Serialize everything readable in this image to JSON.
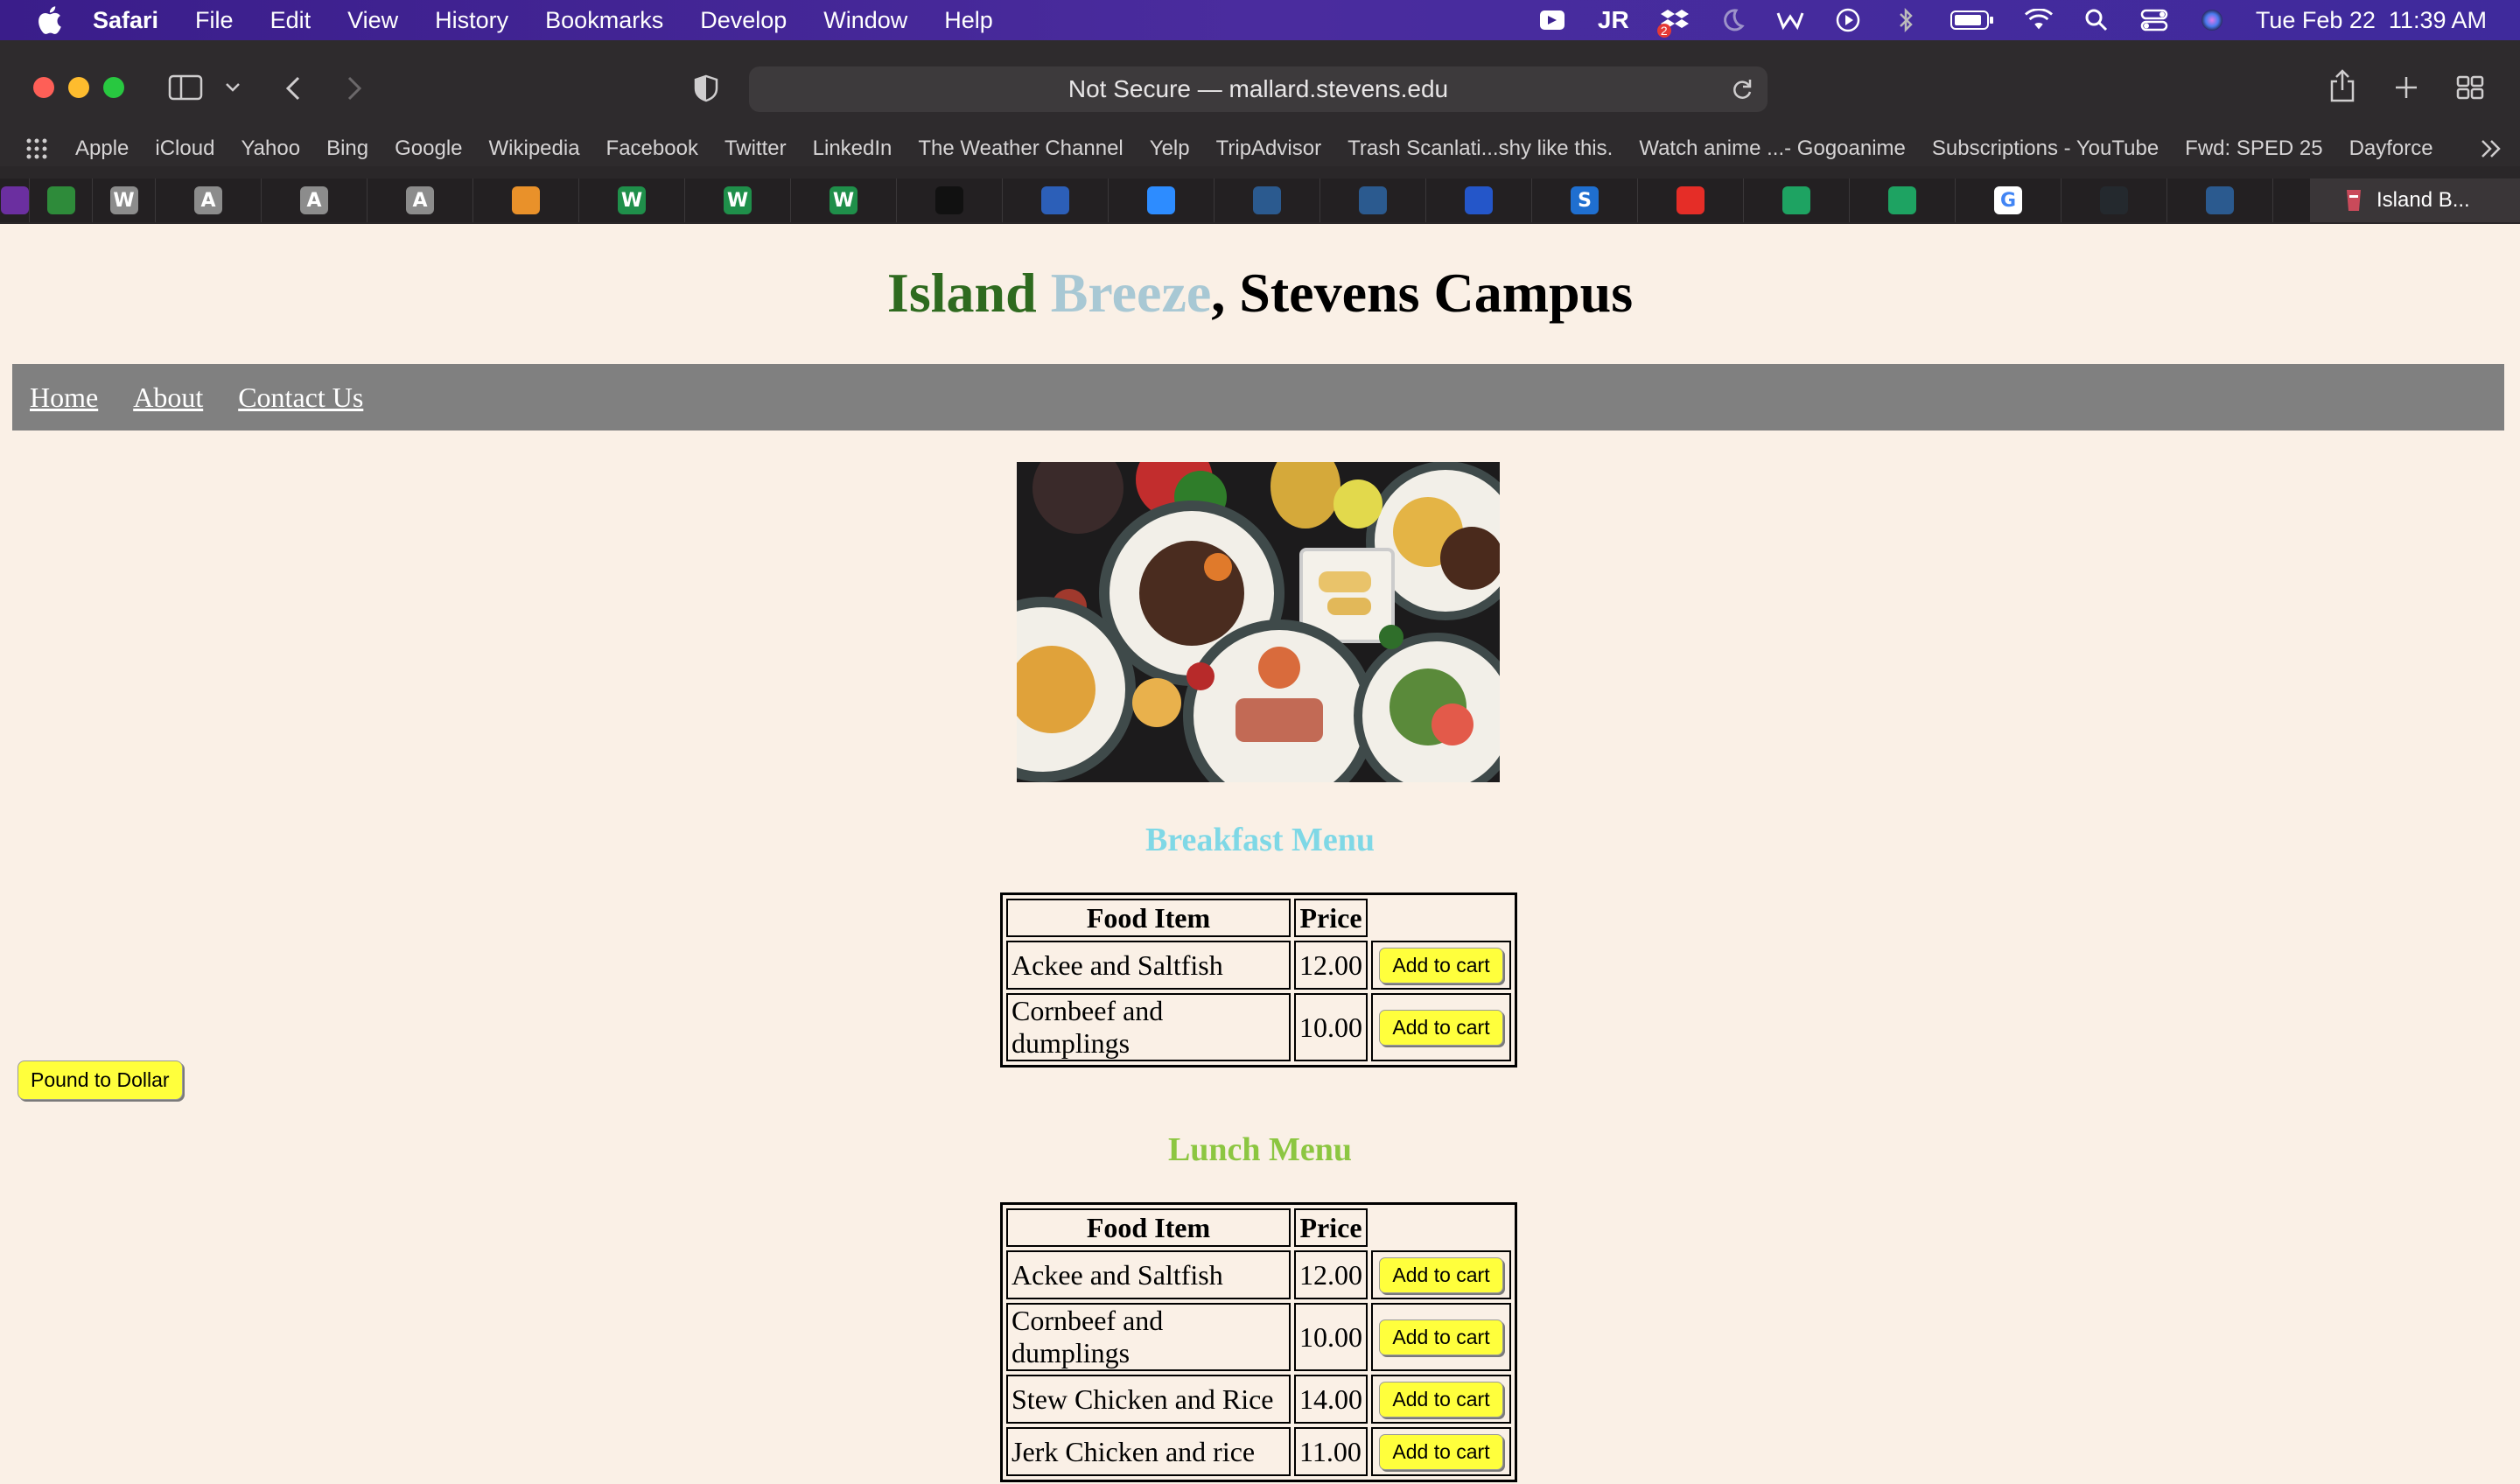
{
  "menubar": {
    "app_name": "Safari",
    "items": [
      "File",
      "Edit",
      "View",
      "History",
      "Bookmarks",
      "Develop",
      "Window",
      "Help"
    ],
    "datetime": "Tue Feb 22  11:39 AM",
    "reader_icon_text": "JR",
    "badge_count": "2"
  },
  "browser": {
    "url_text": "Not Secure — mallard.stevens.edu",
    "bookmarks": [
      "Apple",
      "iCloud",
      "Yahoo",
      "Bing",
      "Google",
      "Wikipedia",
      "Facebook",
      "Twitter",
      "LinkedIn",
      "The Weather Channel",
      "Yelp",
      "TripAdvisor",
      "Trash Scanlati...shy like this.",
      "Watch anime ...- Gogoanime",
      "Subscriptions - YouTube",
      "Fwd: SPED 25",
      "Dayforce"
    ],
    "active_tab_title": "Island B...",
    "tab_icons": [
      "app-icon",
      "chart-icon",
      "w-icon",
      "a-icon",
      "a-icon",
      "a-icon",
      "stack-icon",
      "w3-icon",
      "w3-icon",
      "w3-icon",
      "mask-icon",
      "shield-icon",
      "camera-icon",
      "tile-icon",
      "tile-icon",
      "spiral-icon",
      "s-icon",
      "youtube-icon",
      "drive-icon",
      "drive-icon",
      "google-icon",
      "github-icon",
      "tile-icon"
    ],
    "tab_letters": [
      "",
      "",
      "W",
      "A",
      "A",
      "A",
      "",
      "W",
      "W",
      "W",
      "",
      "",
      "",
      "",
      "",
      "",
      "S",
      "",
      "",
      "",
      "G",
      "",
      ""
    ],
    "tab_colors": [
      "#6b2fa0",
      "#2e8b3a",
      "#8c8c8c",
      "#8c8c8c",
      "#8c8c8c",
      "#8c8c8c",
      "#e9912a",
      "#1f8f4a",
      "#1f8f4a",
      "#1f8f4a",
      "#111111",
      "#2c5fb8",
      "#2d8cff",
      "#2b5a8f",
      "#2b5a8f",
      "#2456c9",
      "#1f6fd0",
      "#e52d27",
      "#1ea362",
      "#1ea362",
      "#ffffff",
      "#24292e",
      "#2b5a8f"
    ]
  },
  "site": {
    "title_island": "Island",
    "title_breeze": "Breeze",
    "title_rest": ", Stevens Campus",
    "colors": {
      "island": "#2e6a1f",
      "breeze": "#a8c8d4",
      "breakfast": "#7fd8e6",
      "lunch": "#8cc641"
    },
    "nav": [
      "Home",
      "About",
      "Contact Us"
    ],
    "pound_button": "Pound to Dollar",
    "breakfast": {
      "heading": "Breakfast Menu",
      "col_food": "Food Item",
      "col_price": "Price",
      "cart_label": "Add to cart",
      "rows": [
        {
          "item": "Ackee and Saltfish",
          "price": "12.00"
        },
        {
          "item": "Cornbeef and dumplings",
          "price": "10.00"
        }
      ]
    },
    "lunch": {
      "heading": "Lunch Menu",
      "col_food": "Food Item",
      "col_price": "Price",
      "cart_label": "Add to cart",
      "rows": [
        {
          "item": "Ackee and Saltfish",
          "price": "12.00"
        },
        {
          "item": "Cornbeef and dumplings",
          "price": "10.00"
        },
        {
          "item": "Stew Chicken and Rice",
          "price": "14.00"
        },
        {
          "item": "Jerk Chicken and rice",
          "price": "11.00"
        }
      ]
    }
  }
}
